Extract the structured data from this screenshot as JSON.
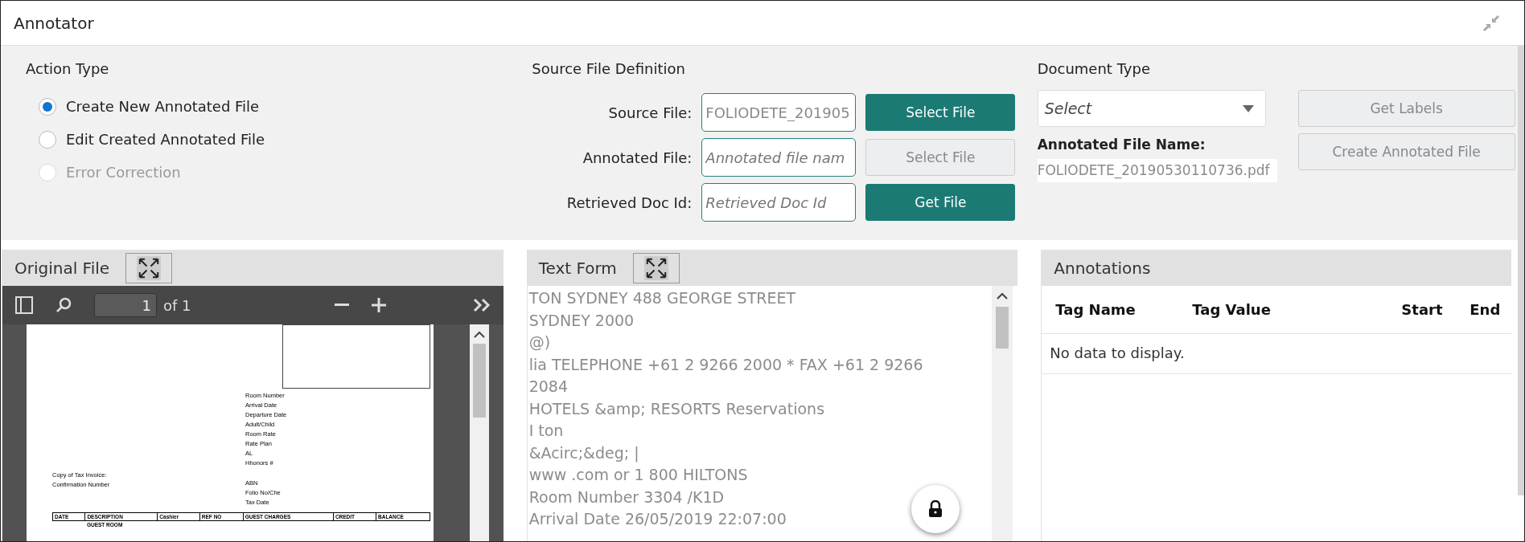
{
  "window": {
    "title": "Annotator"
  },
  "action_type": {
    "heading": "Action Type",
    "options": [
      {
        "label": "Create New Annotated File",
        "selected": true,
        "disabled": false
      },
      {
        "label": "Edit Created Annotated File",
        "selected": false,
        "disabled": false
      },
      {
        "label": "Error Correction",
        "selected": false,
        "disabled": true
      }
    ]
  },
  "source_file_definition": {
    "heading": "Source File Definition",
    "rows": [
      {
        "label": "Source File:",
        "value": "FOLIODETE_201905",
        "button": {
          "label": "Select File",
          "disabled": false
        }
      },
      {
        "label": "Annotated File:",
        "placeholder": "Annotated file nam",
        "button": {
          "label": "Select File",
          "disabled": true
        }
      },
      {
        "label": "Retrieved Doc Id:",
        "placeholder": "Retrieved Doc Id",
        "button": {
          "label": "Get File",
          "disabled": false
        }
      }
    ]
  },
  "document_type": {
    "heading": "Document Type",
    "select": {
      "placeholder": "Select"
    },
    "annotated_file_name": {
      "label": "Annotated File Name:",
      "value": "FOLIODETE_20190530110736.pdf"
    },
    "buttons": [
      {
        "label": "Get Labels",
        "disabled": true
      },
      {
        "label": "Create Annotated File",
        "disabled": true
      }
    ]
  },
  "original_file": {
    "title": "Original File",
    "viewer": {
      "page": "1",
      "page_count": "of 1"
    },
    "document": {
      "fields": [
        {
          "label": "Room Number"
        },
        {
          "label": "Arrival Date"
        },
        {
          "label": "Departure Date"
        },
        {
          "label": "Adult/Child"
        },
        {
          "label": "Room Rate"
        },
        {
          "label": "Rate Plan"
        },
        {
          "label": "AL"
        },
        {
          "label": "Hhonors #"
        }
      ],
      "left_fields": [
        "Copy of Tax Invoice:",
        "Confirmation Number"
      ],
      "right_fields": [
        {
          "label": "ABN"
        },
        {
          "label": "Folio No/Che"
        },
        {
          "label": "Tax Date"
        }
      ],
      "columns": [
        "DATE",
        "DESCRIPTION",
        "Cashier",
        "REF NO",
        "GUEST CHARGES",
        "CREDIT",
        "BALANCE"
      ],
      "rows": [
        [
          "",
          "GUEST ROOM",
          "",
          "",
          "",
          "",
          ""
        ]
      ]
    }
  },
  "text_form": {
    "title": "Text Form",
    "lines": [
      "TON SYDNEY 488 GEORGE STREET",
      "SYDNEY 2000",
      "@)",
      "lia TELEPHONE +61 2 9266 2000 * FAX +61 2 9266",
      "2084",
      "HOTELS &amp; RESORTS Reservations",
      "I ton",
      "&Acirc;&deg; |",
      "www .com or 1 800 HILTONS",
      "Room Number 3304 /K1D",
      "Arrival Date 26/05/2019 22:07:00"
    ]
  },
  "annotations": {
    "title": "Annotations",
    "columns": [
      "Tag Name",
      "Tag Value",
      "Start",
      "End"
    ],
    "empty_message": "No data to display."
  }
}
